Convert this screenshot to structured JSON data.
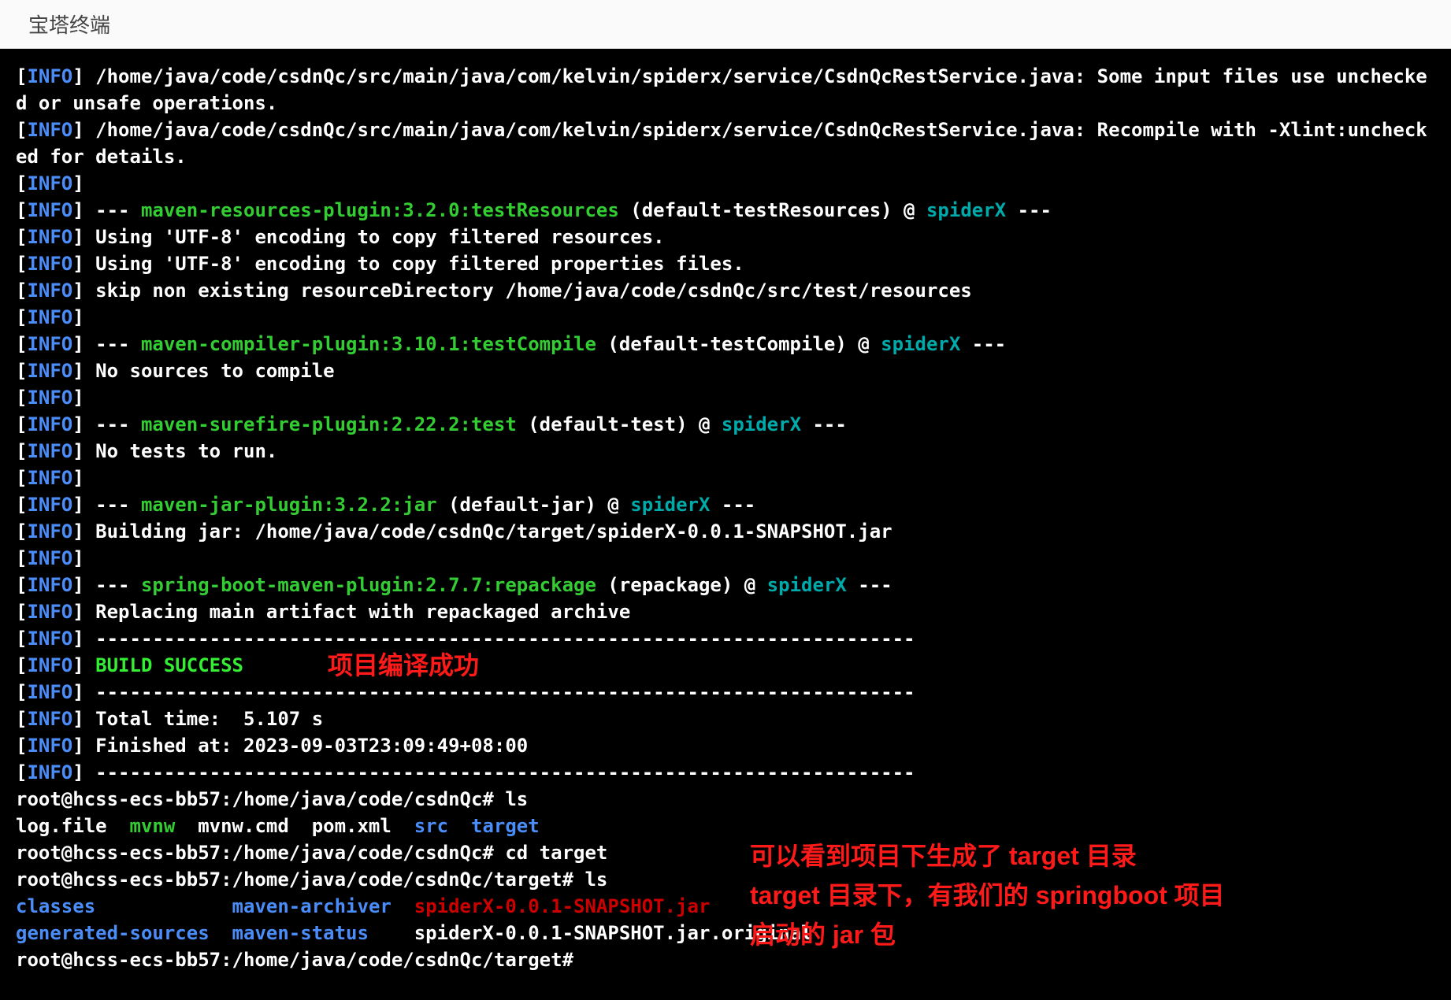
{
  "header": {
    "title": "宝塔终端"
  },
  "info_label": "INFO",
  "lines": {
    "l1_text": " /home/java/code/csdnQc/src/main/java/com/kelvin/spiderx/service/CsdnQcRestService.java: Some input files use unchecked or unsafe operations.",
    "l2_text": " /home/java/code/csdnQc/src/main/java/com/kelvin/spiderx/service/CsdnQcRestService.java: Recompile with -Xlint:unchecked for details.",
    "l4_dash_pre": " --- ",
    "l4_plugin": "maven-resources-plugin:3.2.0:testResources",
    "l4_mid": " (default-testResources) @ ",
    "l4_proj": "spiderX",
    "l4_dash_post": " ---",
    "l5_text": " Using 'UTF-8' encoding to copy filtered resources.",
    "l6_text": " Using 'UTF-8' encoding to copy filtered properties files.",
    "l7_text": " skip non existing resourceDirectory /home/java/code/csdnQc/src/test/resources",
    "l9_plugin": "maven-compiler-plugin:3.10.1:testCompile",
    "l9_mid": " (default-testCompile) @ ",
    "l10_text": " No sources to compile",
    "l12_plugin": "maven-surefire-plugin:2.22.2:test",
    "l12_mid": " (default-test) @ ",
    "l13_text": " No tests to run.",
    "l15_plugin": "maven-jar-plugin:3.2.2:jar",
    "l15_mid": " (default-jar) @ ",
    "l16_text": " Building jar: /home/java/code/csdnQc/target/spiderX-0.0.1-SNAPSHOT.jar",
    "l18_plugin": "spring-boot-maven-plugin:2.7.7:repackage",
    "l18_mid": " (repackage) @ ",
    "l19_text": " Replacing main artifact with repackaged archive",
    "l20_dashes": " ------------------------------------------------------------------------",
    "l21_build": "BUILD SUCCESS",
    "l23_text": " Total time:  5.107 s",
    "l24_text": " Finished at: 2023-09-03T23:09:49+08:00"
  },
  "shell": {
    "prompt1": "root@hcss-ecs-bb57:/home/java/code/csdnQc# ",
    "cmd_ls": "ls",
    "ls1_a": "log.file  ",
    "ls1_mvnw": "mvnw",
    "ls1_b": "  mvnw.cmd  pom.xml  ",
    "ls1_src": "src",
    "ls1_sp": "  ",
    "ls1_target": "target",
    "prompt2": "root@hcss-ecs-bb57:/home/java/code/csdnQc# ",
    "cmd_cd": "cd target",
    "prompt3": "root@hcss-ecs-bb57:/home/java/code/csdnQc/target# ",
    "ls2_classes": "classes",
    "ls2_sp1": "            ",
    "ls2_archiver": "maven-archiver",
    "ls2_sp2": "  ",
    "ls2_jar": "spiderX-0.0.1-SNAPSHOT.jar",
    "ls2_gensrc": "generated-sources",
    "ls2_sp3": "  ",
    "ls2_status": "maven-status",
    "ls2_sp4": "    ",
    "ls2_orig": "spiderX-0.0.1-SNAPSHOT.jar.original",
    "prompt4": "root@hcss-ecs-bb57:/home/java/code/csdnQc/target# "
  },
  "annotations": {
    "ann1": "项目编译成功",
    "ann2_l1": "可以看到项目下生成了 target 目录",
    "ann2_l2": "target 目录下，有我们的 springboot 项目",
    "ann2_l3": "启动的 jar 包"
  }
}
